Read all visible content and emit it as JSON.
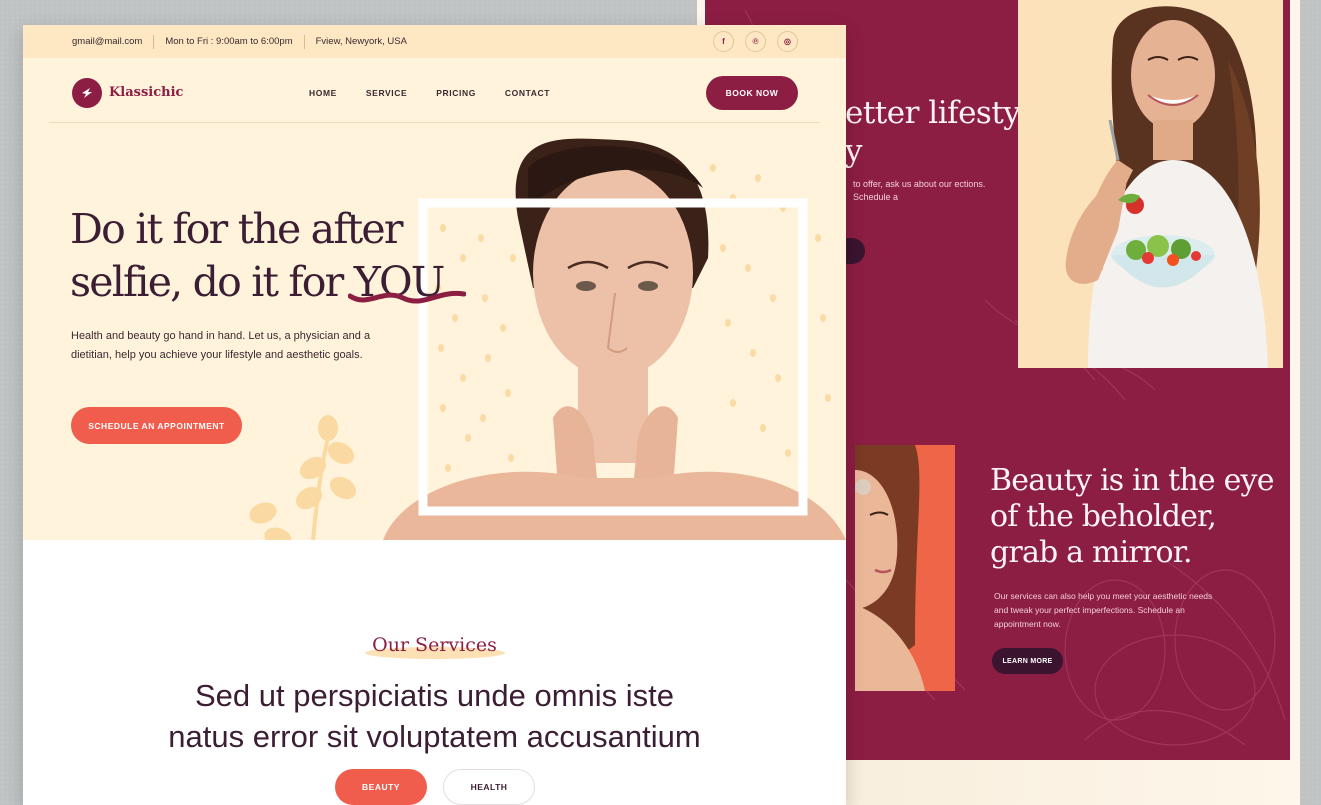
{
  "back_panel": {
    "heading_1_line1": "etter lifestyle,",
    "heading_1_line2": "y",
    "text_1": "to offer, ask us about our ections. Schedule a",
    "heading_2": "Beauty is in the eye of the beholder, grab a mirror.",
    "text_2": "Our services can also help you meet your aesthetic needs and tweak your perfect imperfections. Schedule an appointment now.",
    "learn_more_label": "LEARN MORE",
    "colors": {
      "maroon": "#8c1d43",
      "dark_button": "#3b1430",
      "coral": "#ef6548"
    }
  },
  "topbar": {
    "email": "gmail@mail.com",
    "hours": "Mon to Fri : 9:00am to 6:00pm",
    "address": "Fview, Newyork, USA",
    "social_icons": [
      "facebook-icon",
      "pinterest-icon",
      "instagram-icon"
    ],
    "social_glyphs": [
      "f",
      "℗",
      "◎"
    ]
  },
  "nav": {
    "brand": "Klassichic",
    "links": [
      "HOME",
      "SERVICE",
      "PRICING",
      "CONTACT"
    ],
    "cta_label": "BOOK NOW"
  },
  "hero": {
    "title_line1": "Do it for the after",
    "title_line2_prefix": "selfie, do it for ",
    "title_highlight": "YOU",
    "description": "Health and beauty go hand in hand. Let us, a physician and a dietitian, help you achieve your lifestyle and aesthetic goals.",
    "cta_label": "SCHEDULE AN APPOINTMENT"
  },
  "services": {
    "kicker": "Our Services",
    "title_line1": "Sed ut perspiciatis unde omnis iste",
    "title_line2": "natus error sit voluptatem accusantium",
    "tabs": [
      "BEAUTY",
      "HEALTH"
    ]
  },
  "colors": {
    "brand": "#8c1d43",
    "accent": "#f15d4c",
    "topbar_bg": "#fde8c3",
    "hero_bg": "#fff3dc",
    "text_dark": "#3b1e33"
  }
}
